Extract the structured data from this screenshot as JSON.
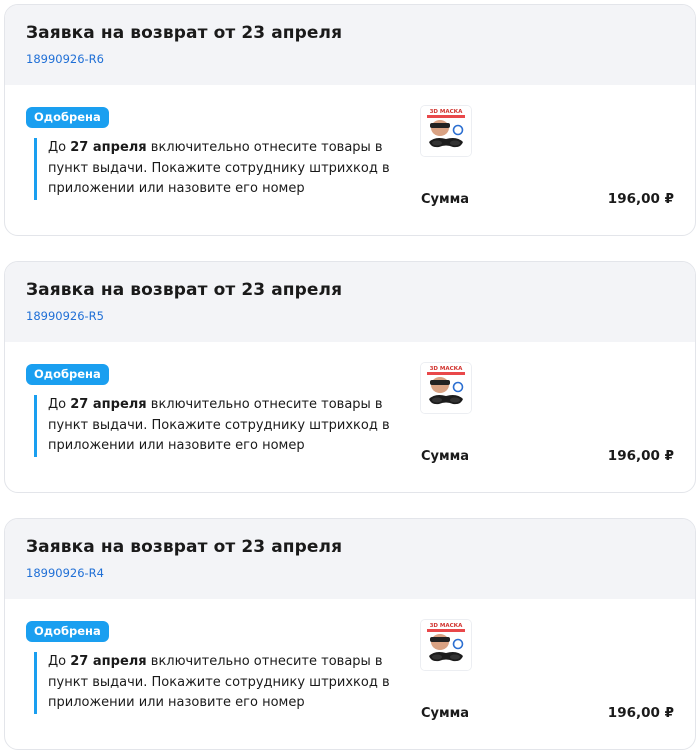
{
  "returns": [
    {
      "title": "Заявка на возврат от 23 апреля",
      "id": "18990926-R6",
      "status": "Одобрена",
      "instruction_prefix": "До",
      "deadline": "27 апреля",
      "instruction_rest": "включительно отнесите товары в пункт выдачи. Покажите сотруднику штрихкод в приложении или назовите его номер",
      "sum_label": "Сумма",
      "sum_value": "196,00 ₽",
      "product_image_text": "3D МАСКА",
      "product_icon": "sleep-mask-product-icon"
    },
    {
      "title": "Заявка на возврат от 23 апреля",
      "id": "18990926-R5",
      "status": "Одобрена",
      "instruction_prefix": "До",
      "deadline": "27 апреля",
      "instruction_rest": "включительно отнесите товары в пункт выдачи. Покажите сотруднику штрихкод в приложении или назовите его номер",
      "sum_label": "Сумма",
      "sum_value": "196,00 ₽",
      "product_image_text": "3D МАСКА",
      "product_icon": "sleep-mask-product-icon"
    },
    {
      "title": "Заявка на возврат от 23 апреля",
      "id": "18990926-R4",
      "status": "Одобрена",
      "instruction_prefix": "До",
      "deadline": "27 апреля",
      "instruction_rest": "включительно отнесите товары в пункт выдачи. Покажите сотруднику штрихкод в приложении или назовите его номер",
      "sum_label": "Сумма",
      "sum_value": "196,00 ₽",
      "product_image_text": "3D МАСКА",
      "product_icon": "sleep-mask-product-icon"
    }
  ],
  "colors": {
    "accent": "#1a9ff0",
    "link": "#1f6fd6",
    "header_bg": "#f3f4f7"
  }
}
